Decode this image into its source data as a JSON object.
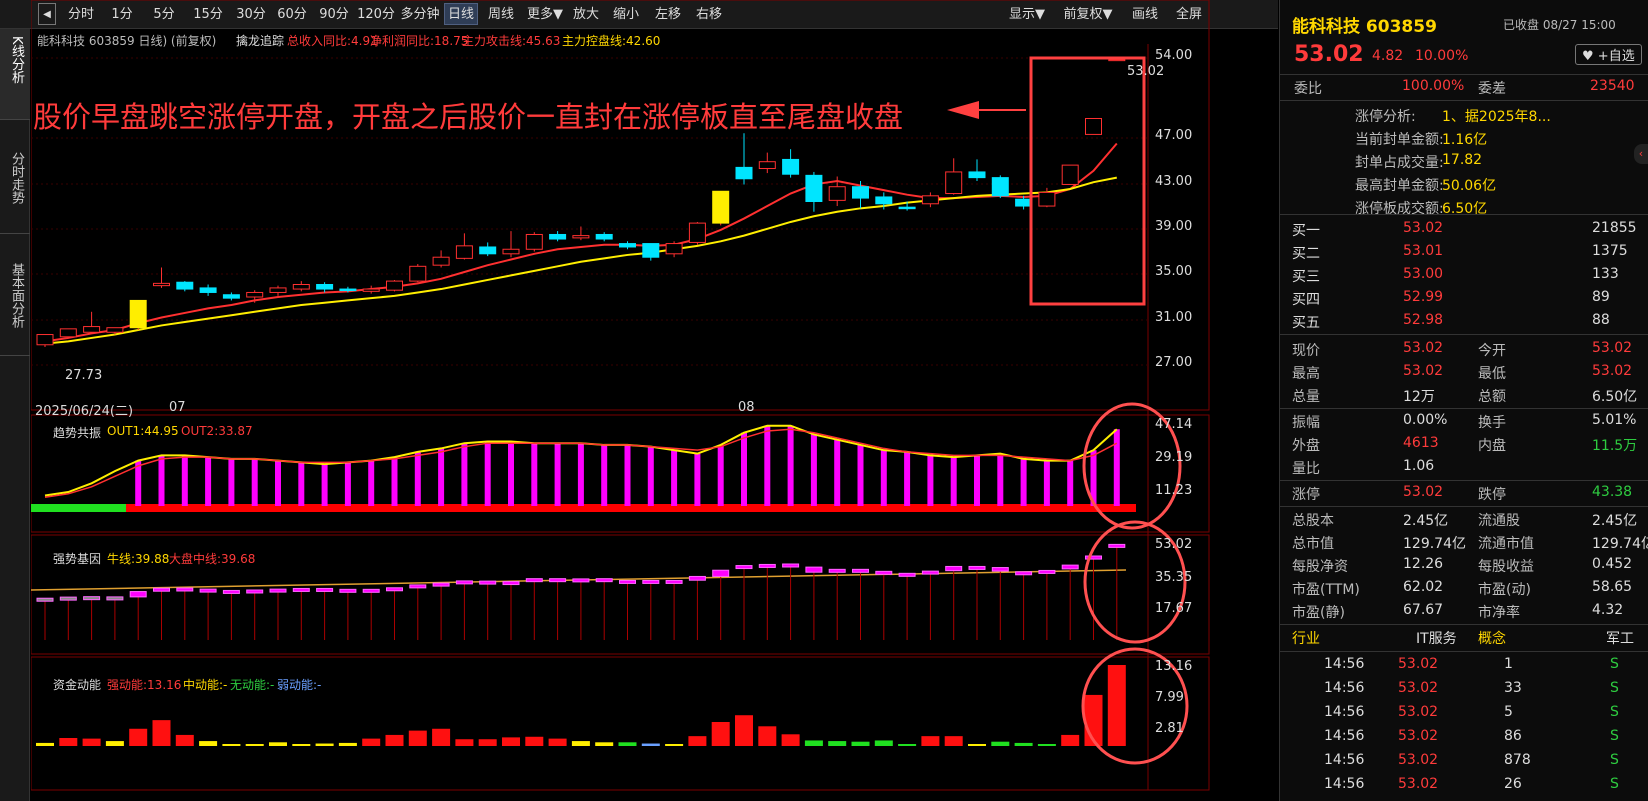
{
  "toolbar": {
    "periods": [
      "分时",
      "1分",
      "5分",
      "15分",
      "30分",
      "60分",
      "90分",
      "120分",
      "多分钟",
      "日线",
      "周线",
      "更多▼",
      "放大",
      "缩小",
      "左移",
      "右移"
    ],
    "right": [
      "显示▼",
      "前复权▼",
      "画线",
      "全屏"
    ]
  },
  "left_nav": [
    "K线分析",
    "分时走势",
    "基本面分析"
  ],
  "kline": {
    "title": "能科科技 603859 日线) (前复权)",
    "indicator_name": "擒龙追踪",
    "ind1": "总收入同比:4.91",
    "ind2": "净利润同比:18.75",
    "ind3": "主力攻击线:45.63",
    "ind4": "主力控盘线:42.60",
    "annotation": "股价早盘跳空涨停开盘，开盘之后股价一直封在涨停板直至尾盘收盘",
    "high_label": "53.02",
    "low_label": "27.73",
    "date_label": "2025/06/24(二)",
    "month1": "07",
    "month2": "08",
    "yaxis": [
      "54.00",
      "47.00",
      "43.00",
      "39.00",
      "35.00",
      "31.00",
      "27.00"
    ]
  },
  "panel1": {
    "name": "趋势共振",
    "out1": "OUT1:44.95",
    "out2": "OUT2:33.87",
    "yaxis": [
      "47.14",
      "29.19",
      "11.23"
    ]
  },
  "panel2": {
    "name": "强势基因",
    "a": "牛线:39.88",
    "b": "大盘中线:39.68",
    "yaxis": [
      "53.02",
      "35.35",
      "17.67"
    ]
  },
  "panel3": {
    "name": "资金动能",
    "a": "强动能:13.16",
    "b": "中动能:-",
    "c": "无动能:-",
    "d": "弱动能:-",
    "yaxis": [
      "13.16",
      "7.99",
      "2.81"
    ]
  },
  "chart_data": {
    "type": "candlestick",
    "ylim": [
      27,
      54
    ],
    "candles": [
      [
        27.9,
        28.8,
        28.3,
        27.7
      ],
      [
        28.6,
        29.3,
        28.6,
        29.3
      ],
      [
        29.0,
        29.5,
        30.8,
        29.0
      ],
      [
        29.0,
        29.4,
        29.4,
        28.8
      ],
      [
        29.4,
        31.8,
        31.8,
        29.2
      ],
      [
        33.1,
        33.3,
        34.7,
        32.9
      ],
      [
        33.4,
        32.8,
        33.5,
        32.6
      ],
      [
        32.9,
        32.5,
        33.2,
        32.2
      ],
      [
        32.3,
        32.0,
        32.5,
        31.8
      ],
      [
        32.1,
        32.5,
        32.7,
        31.6
      ],
      [
        32.5,
        32.9,
        33.1,
        32.2
      ],
      [
        32.8,
        33.2,
        33.5,
        32.6
      ],
      [
        33.2,
        32.8,
        33.4,
        32.5
      ],
      [
        32.8,
        32.7,
        33.0,
        32.5
      ],
      [
        32.6,
        32.8,
        33.1,
        32.4
      ],
      [
        32.7,
        33.5,
        33.6,
        32.6
      ],
      [
        33.5,
        34.8,
        35.0,
        33.4
      ],
      [
        34.9,
        35.6,
        36.2,
        34.7
      ],
      [
        35.5,
        36.6,
        37.7,
        35.4
      ],
      [
        36.5,
        35.9,
        36.9,
        35.7
      ],
      [
        35.9,
        36.3,
        37.9,
        35.6
      ],
      [
        36.3,
        37.6,
        37.8,
        36.1
      ],
      [
        37.6,
        37.2,
        37.9,
        37.0
      ],
      [
        37.3,
        37.5,
        38.3,
        37.1
      ],
      [
        37.6,
        37.2,
        37.8,
        37.0
      ],
      [
        36.8,
        36.5,
        37.0,
        36.3
      ],
      [
        36.8,
        35.6,
        36.8,
        35.3
      ],
      [
        35.9,
        36.8,
        37.0,
        35.6
      ],
      [
        36.9,
        38.6,
        38.7,
        36.7
      ],
      [
        38.6,
        41.4,
        41.4,
        38.4
      ],
      [
        43.5,
        42.5,
        46.5,
        42.0
      ],
      [
        43.4,
        44.0,
        44.8,
        43.0
      ],
      [
        44.2,
        42.9,
        45.1,
        42.6
      ],
      [
        42.8,
        40.5,
        43.1,
        39.6
      ],
      [
        40.6,
        41.8,
        42.7,
        40.1
      ],
      [
        41.8,
        40.8,
        42.3,
        39.9
      ],
      [
        40.9,
        40.3,
        41.3,
        39.8
      ],
      [
        40.0,
        39.9,
        40.5,
        39.7
      ],
      [
        40.3,
        41.0,
        41.3,
        40.0
      ],
      [
        41.2,
        43.1,
        44.3,
        41.1
      ],
      [
        43.1,
        42.6,
        44.2,
        42.3
      ],
      [
        42.6,
        41.0,
        42.8,
        40.8
      ],
      [
        40.7,
        40.1,
        41.0,
        39.8
      ],
      [
        40.1,
        41.3,
        41.7,
        40.0
      ],
      [
        42.0,
        43.7,
        43.7,
        42.0
      ],
      [
        46.4,
        47.8,
        47.8,
        46.4
      ],
      [
        53.02,
        53.02,
        53.02,
        53.02
      ]
    ],
    "ma5": [
      28.2,
      28.5,
      28.9,
      29.2,
      29.8,
      30.3,
      30.7,
      31.1,
      31.4,
      31.8,
      32.1,
      32.3,
      32.5,
      32.6,
      32.8,
      33.0,
      33.3,
      33.7,
      34.3,
      34.9,
      35.4,
      35.9,
      36.3,
      36.5,
      36.7,
      36.7,
      36.6,
      36.7,
      37.2,
      38.0,
      39.0,
      40.1,
      41.2,
      42.0,
      42.3,
      41.9,
      41.5,
      41.1,
      40.8,
      40.8,
      40.9,
      41.0,
      40.9,
      41.0,
      41.6,
      43.2,
      45.6
    ],
    "ma10": [
      28.0,
      28.2,
      28.5,
      28.8,
      29.2,
      29.6,
      29.9,
      30.2,
      30.5,
      30.8,
      31.1,
      31.4,
      31.6,
      31.8,
      32.0,
      32.2,
      32.5,
      32.8,
      33.2,
      33.6,
      34.0,
      34.4,
      34.8,
      35.2,
      35.5,
      35.8,
      36.0,
      36.3,
      36.6,
      37.0,
      37.5,
      38.1,
      38.7,
      39.2,
      39.6,
      39.9,
      40.1,
      40.4,
      40.6,
      40.8,
      41.0,
      41.1,
      41.2,
      41.3,
      41.6,
      42.2,
      42.6
    ],
    "mom": [
      0.5,
      1.3,
      1.2,
      0.8,
      2.8,
      4.2,
      1.8,
      0.8,
      0.1,
      0.2,
      0.6,
      0.2,
      0.4,
      0.5,
      1.2,
      1.8,
      2.5,
      2.8,
      1.1,
      1.1,
      1.4,
      1.5,
      1.2,
      0.8,
      0.6,
      -0.6,
      -0.4,
      0.1,
      1.6,
      3.9,
      5.0,
      3.2,
      1.9,
      -0.9,
      -0.8,
      -0.7,
      -0.9,
      -0.2,
      1.6,
      1.6,
      0.2,
      -0.7,
      -0.5,
      -0.3,
      1.8,
      8.3,
      13.16
    ]
  },
  "right": {
    "name": "能科科技",
    "code": "603859",
    "status": "已收盘 08/27 15:00",
    "price": "53.02",
    "chg": "4.82",
    "pct": "10.00%",
    "watch": "+自选",
    "weibi_l": "委比",
    "weibi": "100.00%",
    "weicha_l": "委差",
    "weicha": "23540",
    "zt": [
      [
        "涨停分析:",
        "1、据2025年8..."
      ],
      [
        "当前封单金额:",
        "1.16亿"
      ],
      [
        "封单占成交量:",
        "17.82"
      ],
      [
        "最高封单金额:",
        "50.06亿"
      ],
      [
        "涨停板成交额:",
        "6.50亿"
      ]
    ],
    "buy": [
      [
        "买一",
        "53.02",
        "21855"
      ],
      [
        "买二",
        "53.01",
        "1375"
      ],
      [
        "买三",
        "53.00",
        "133"
      ],
      [
        "买四",
        "52.99",
        "89"
      ],
      [
        "买五",
        "52.98",
        "88"
      ]
    ],
    "q1": [
      [
        "现价",
        "53.02",
        "今开",
        "53.02"
      ],
      [
        "最高",
        "53.02",
        "最低",
        "53.02"
      ],
      [
        "总量",
        "12万",
        "总额",
        "6.50亿"
      ]
    ],
    "q2": [
      [
        "振幅",
        "0.00%",
        "换手",
        "5.01%"
      ],
      [
        "外盘",
        "4613",
        "内盘",
        "11.5万"
      ],
      [
        "量比",
        "1.06",
        "",
        ""
      ]
    ],
    "q3": [
      [
        "涨停",
        "53.02",
        "跌停",
        "43.38"
      ]
    ],
    "q4": [
      [
        "总股本",
        "2.45亿",
        "流通股",
        "2.45亿"
      ],
      [
        "总市值",
        "129.74亿",
        "流通市值",
        "129.74亿"
      ],
      [
        "每股净资",
        "12.26",
        "每股收益",
        "0.452"
      ],
      [
        "市盈(TTM)",
        "62.02",
        "市盈(动)",
        "58.65"
      ],
      [
        "市盈(静)",
        "67.67",
        "市净率",
        "4.32"
      ]
    ],
    "ind": [
      "行业",
      "IT服务",
      "概念",
      "军工"
    ],
    "ticks": [
      [
        "14:56",
        "53.02",
        "1",
        "S"
      ],
      [
        "14:56",
        "53.02",
        "33",
        "S"
      ],
      [
        "14:56",
        "53.02",
        "5",
        "S"
      ],
      [
        "14:56",
        "53.02",
        "86",
        "S"
      ],
      [
        "14:56",
        "53.02",
        "878",
        "S"
      ],
      [
        "14:56",
        "53.02",
        "26",
        "S"
      ]
    ]
  }
}
